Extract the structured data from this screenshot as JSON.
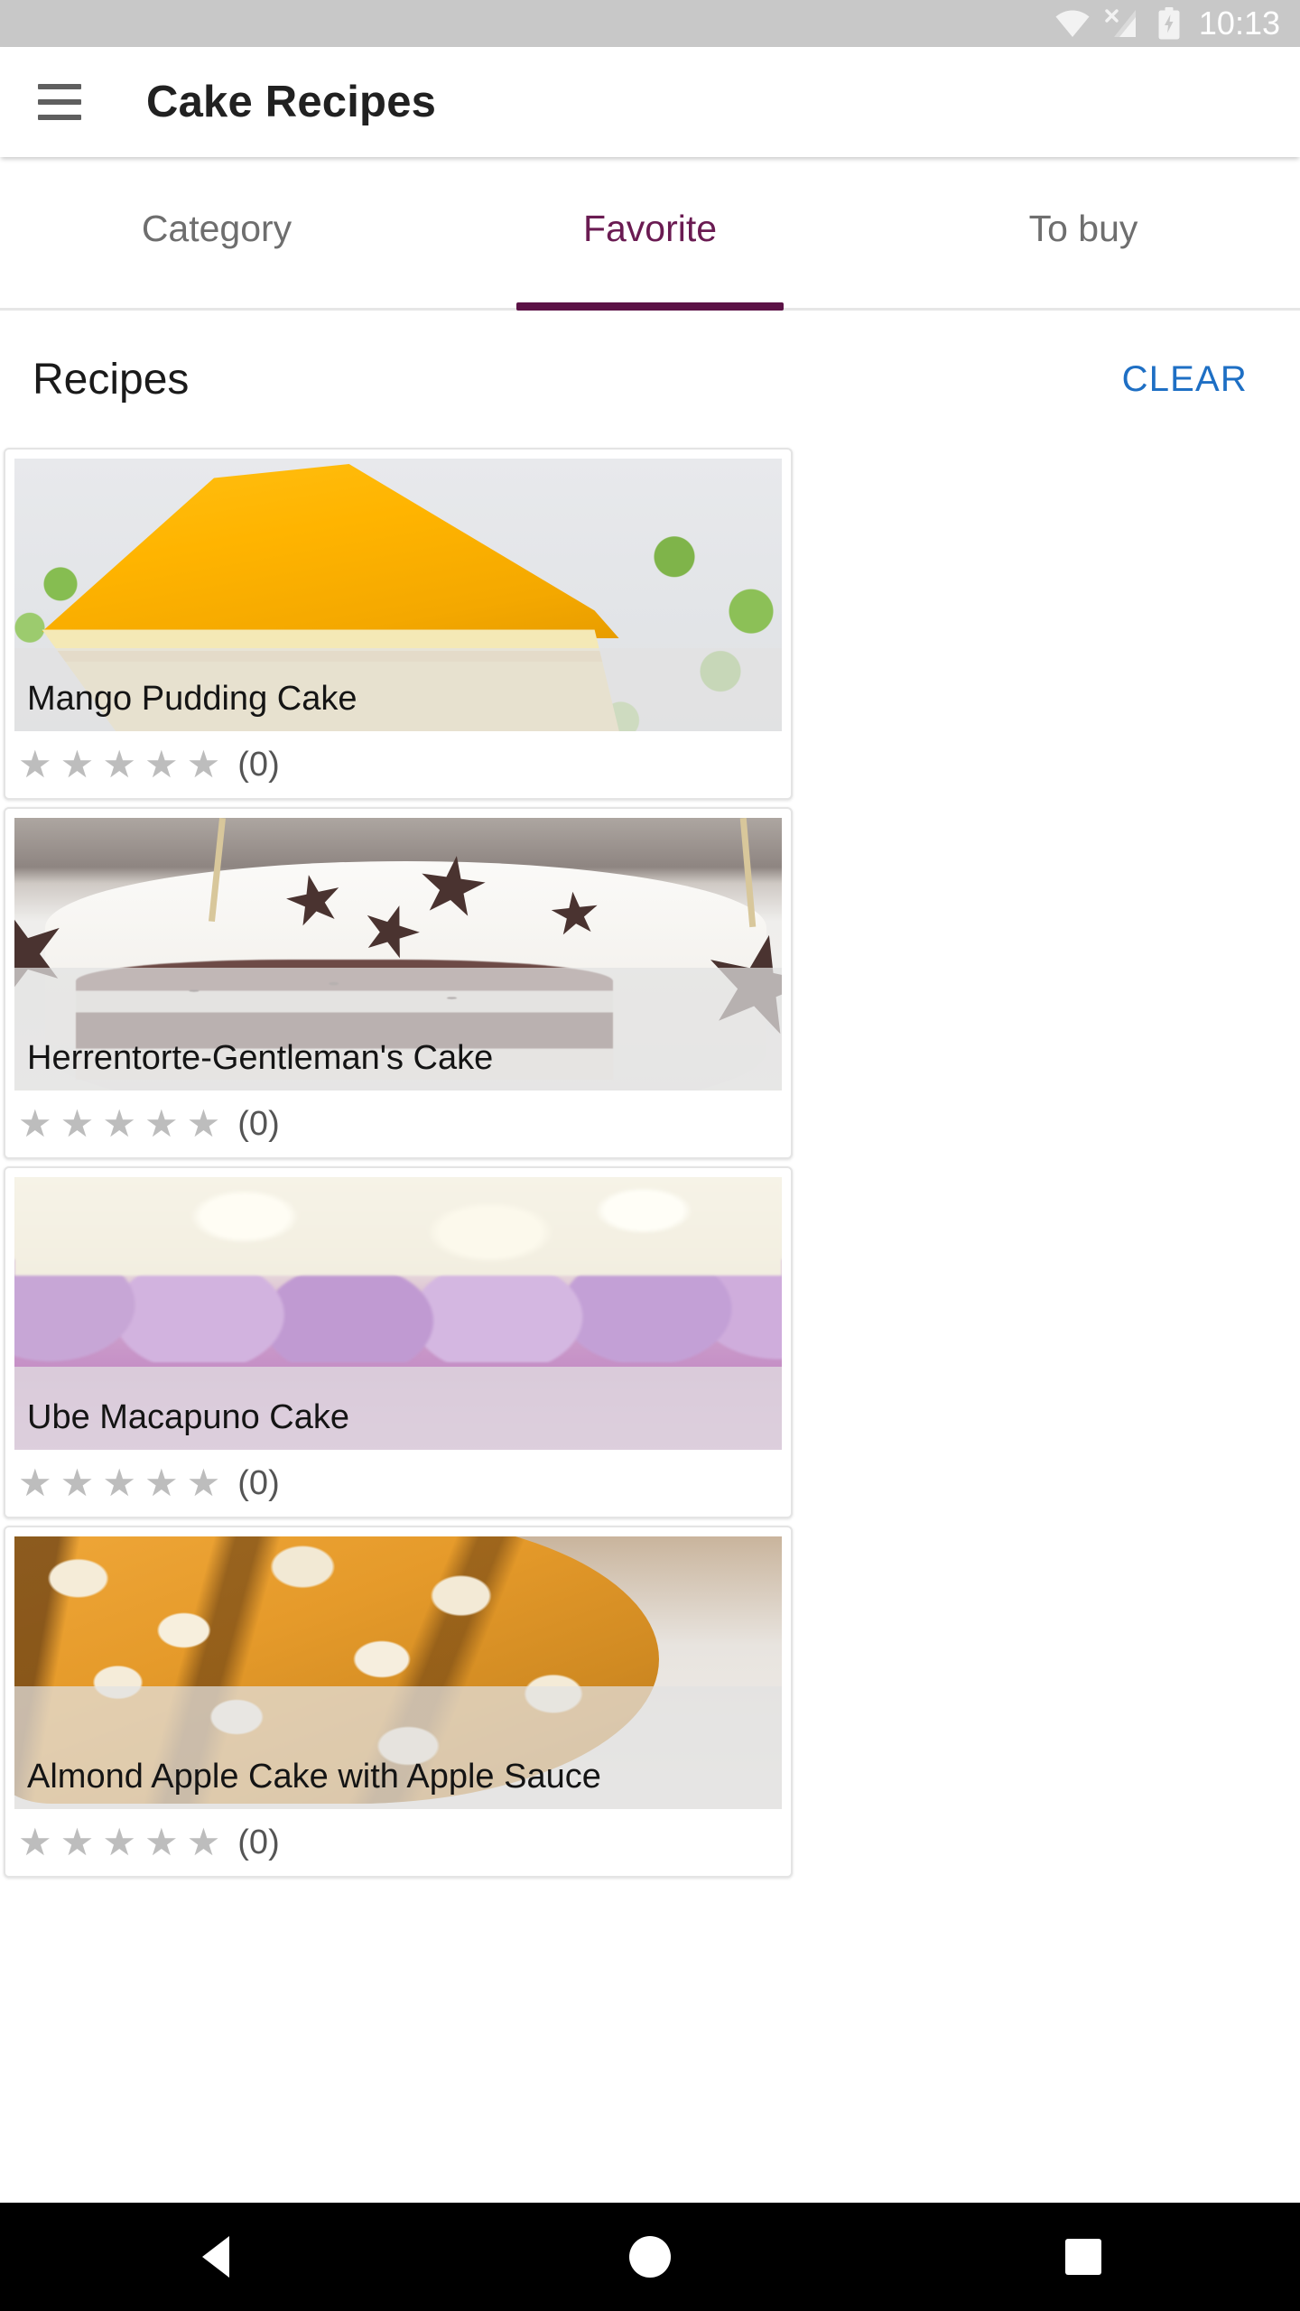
{
  "status_bar": {
    "time": "10:13",
    "icons": [
      "wifi-icon",
      "signal-no-sim-icon",
      "battery-charging-icon"
    ],
    "background": "#c8c8c8"
  },
  "app_bar": {
    "menu_icon": "hamburger-menu-icon",
    "title": "Cake Recipes"
  },
  "tabs": {
    "selected_index": 1,
    "accent_color": "#5c1246",
    "items": [
      {
        "label": "Category",
        "selected": false
      },
      {
        "label": "Favorite",
        "selected": true
      },
      {
        "label": "To buy",
        "selected": false
      }
    ]
  },
  "section": {
    "title": "Recipes",
    "clear_label": "CLEAR",
    "clear_color": "#1e6fc4"
  },
  "recipes": [
    {
      "title": "Mango Pudding Cake",
      "rating": 0,
      "rating_count": "(0)",
      "stars_total": 5,
      "photo": "mango-pudding-cake-photo"
    },
    {
      "title": "Herrentorte-Gentleman's Cake",
      "rating": 0,
      "rating_count": "(0)",
      "stars_total": 5,
      "photo": "herrentorte-cake-photo"
    },
    {
      "title": "Ube Macapuno Cake",
      "rating": 0,
      "rating_count": "(0)",
      "stars_total": 5,
      "photo": "ube-macapuno-cake-photo"
    },
    {
      "title": "Almond Apple Cake with Apple Sauce",
      "rating": 0,
      "rating_count": "(0)",
      "stars_total": 5,
      "photo": "almond-apple-cake-photo"
    }
  ],
  "star_glyph": "★",
  "nav_bar": {
    "back_label": "back-icon",
    "home_label": "home-icon",
    "recents_label": "recents-icon"
  }
}
